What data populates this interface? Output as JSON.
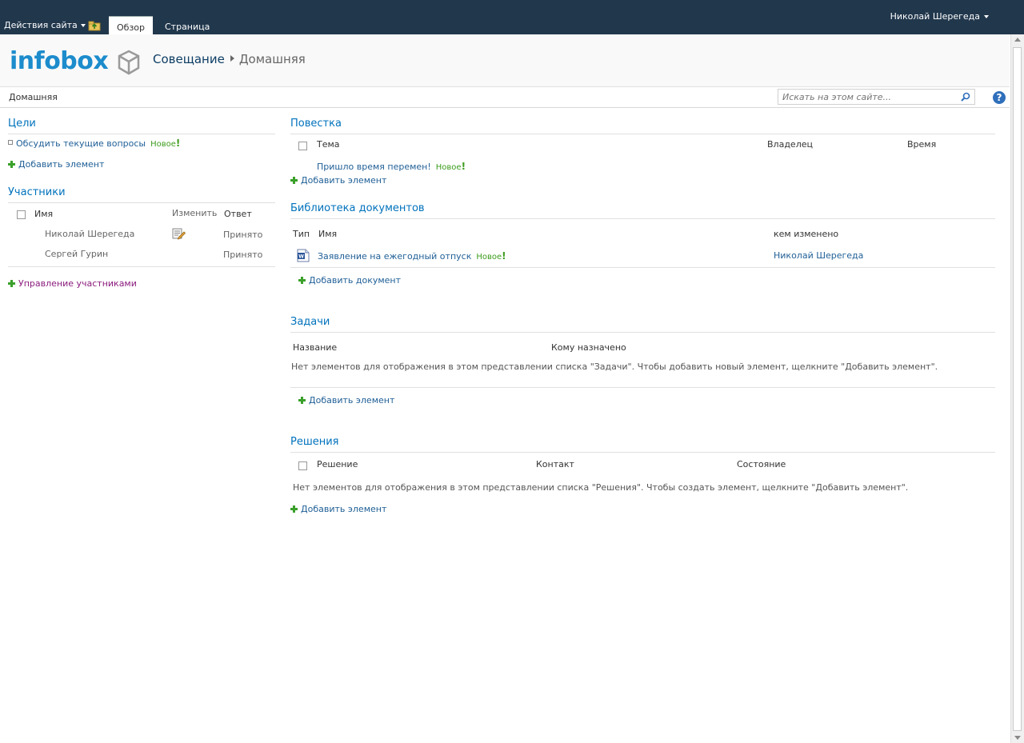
{
  "ribbon": {
    "site_actions": "Действия сайта",
    "tabs": [
      {
        "label": "Обзор"
      },
      {
        "label": "Страница"
      }
    ],
    "user": "Николай Шерегеда"
  },
  "title": {
    "logo_text": "infobox",
    "site": "Совещание",
    "current": "Домашняя"
  },
  "topnav": {
    "home": "Домашняя",
    "search_placeholder": "Искать на этом сайте..."
  },
  "left": {
    "goals": {
      "title": "Цели",
      "item": "Обсудить текущие вопросы",
      "new_label": "Новое",
      "add": "Добавить элемент"
    },
    "attendees": {
      "title": "Участники",
      "col_name": "Имя",
      "col_edit": "Изменить",
      "col_response": "Ответ",
      "rows": [
        {
          "name": "Николай Шерегеда",
          "response": "Принято"
        },
        {
          "name": "Сергей Гурин",
          "response": "Принято"
        }
      ],
      "manage": "Управление участниками"
    }
  },
  "right": {
    "agenda": {
      "title": "Повестка",
      "col_subject": "Тема",
      "col_owner": "Владелец",
      "col_time": "Время",
      "item": "Пришло время перемен!",
      "new_label": "Новое",
      "add": "Добавить элемент"
    },
    "library": {
      "title": "Библиотека документов",
      "col_type": "Тип",
      "col_name": "Имя",
      "col_modified_by": "кем изменено",
      "doc_name": "Заявление на ежегодный отпуск",
      "new_label": "Новое",
      "doc_modified_by": "Николай Шерегеда",
      "add": "Добавить документ"
    },
    "tasks": {
      "title": "Задачи",
      "col_title": "Название",
      "col_assigned": "Кому назначено",
      "empty": "Нет элементов для отображения в этом представлении списка \"Задачи\". Чтобы добавить новый элемент, щелкните \"Добавить элемент\".",
      "add": "Добавить элемент"
    },
    "decisions": {
      "title": "Решения",
      "col_decision": "Решение",
      "col_contact": "Контакт",
      "col_status": "Состояние",
      "empty": "Нет элементов для отображения в этом представлении списка \"Решения\". Чтобы создать элемент, щелкните \"Добавить элемент\".",
      "add": "Добавить элемент"
    }
  },
  "colors": {
    "ribbon_bg": "#21374c",
    "link": "#1f5f96",
    "heading": "#0072bc",
    "new_badge": "#3c9c1c"
  }
}
